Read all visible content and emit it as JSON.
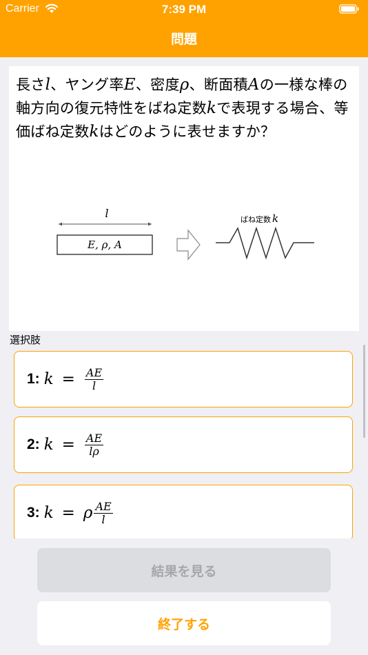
{
  "status_bar": {
    "carrier": "Carrier",
    "time": "7:39 PM"
  },
  "nav": {
    "title": "問題"
  },
  "question": {
    "p1": "長さ",
    "v_l": "l",
    "p2": "、ヤング率",
    "v_E": "E",
    "p3": "、密度",
    "v_rho": "ρ",
    "p4": "、断面積",
    "v_A": "A",
    "p5": "の一様な棒の軸方向の復元特性をばね定数",
    "v_k": "k",
    "p6": "で表現する場合、等価ばね定数",
    "v_k2": "k",
    "p7": "はどのように表せますか？"
  },
  "figure": {
    "length_label": "l",
    "rod_label": "E, ρ, A",
    "spring_label": "ばね定数",
    "spring_var": "k"
  },
  "choices_label": "選択肢",
  "choices": [
    {
      "number": "1:",
      "lhs": "k",
      "eq": "=",
      "prefix": "",
      "num": "AE",
      "den": "l"
    },
    {
      "number": "2:",
      "lhs": "k",
      "eq": "=",
      "prefix": "",
      "num": "AE",
      "den": "lρ"
    },
    {
      "number": "3:",
      "lhs": "k",
      "eq": "=",
      "prefix": "ρ",
      "num": "AE",
      "den": "l"
    }
  ],
  "buttons": {
    "result": "結果を見る",
    "finish": "終了する"
  },
  "colors": {
    "accent": "#ffa200",
    "background": "#efeff4",
    "disabled": "#dcdde0"
  }
}
